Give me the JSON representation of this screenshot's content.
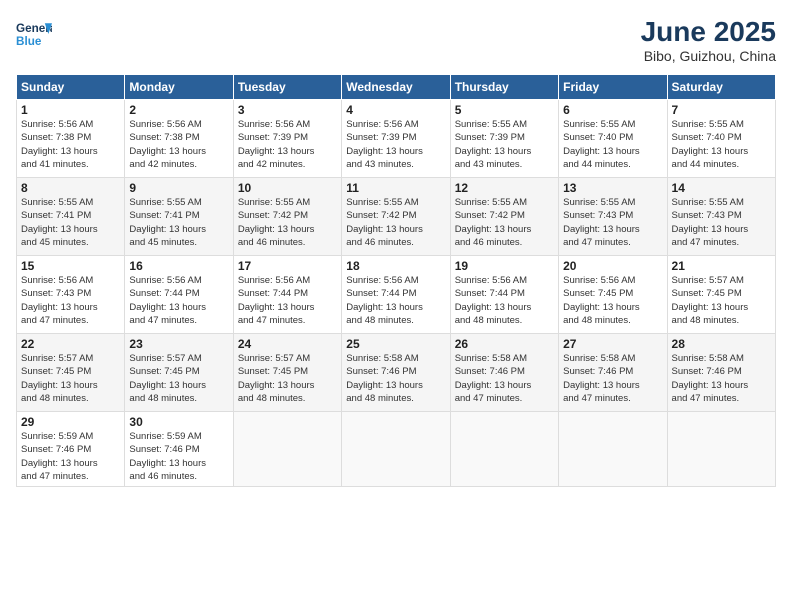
{
  "header": {
    "logo_line1": "General",
    "logo_line2": "Blue",
    "title": "June 2025",
    "subtitle": "Bibo, Guizhou, China"
  },
  "weekdays": [
    "Sunday",
    "Monday",
    "Tuesday",
    "Wednesday",
    "Thursday",
    "Friday",
    "Saturday"
  ],
  "weeks": [
    [
      {
        "day": "1",
        "sunrise": "5:56 AM",
        "sunset": "7:38 PM",
        "daylight": "13 hours and 41 minutes."
      },
      {
        "day": "2",
        "sunrise": "5:56 AM",
        "sunset": "7:38 PM",
        "daylight": "13 hours and 42 minutes."
      },
      {
        "day": "3",
        "sunrise": "5:56 AM",
        "sunset": "7:39 PM",
        "daylight": "13 hours and 42 minutes."
      },
      {
        "day": "4",
        "sunrise": "5:56 AM",
        "sunset": "7:39 PM",
        "daylight": "13 hours and 43 minutes."
      },
      {
        "day": "5",
        "sunrise": "5:55 AM",
        "sunset": "7:39 PM",
        "daylight": "13 hours and 43 minutes."
      },
      {
        "day": "6",
        "sunrise": "5:55 AM",
        "sunset": "7:40 PM",
        "daylight": "13 hours and 44 minutes."
      },
      {
        "day": "7",
        "sunrise": "5:55 AM",
        "sunset": "7:40 PM",
        "daylight": "13 hours and 44 minutes."
      }
    ],
    [
      {
        "day": "8",
        "sunrise": "5:55 AM",
        "sunset": "7:41 PM",
        "daylight": "13 hours and 45 minutes."
      },
      {
        "day": "9",
        "sunrise": "5:55 AM",
        "sunset": "7:41 PM",
        "daylight": "13 hours and 45 minutes."
      },
      {
        "day": "10",
        "sunrise": "5:55 AM",
        "sunset": "7:42 PM",
        "daylight": "13 hours and 46 minutes."
      },
      {
        "day": "11",
        "sunrise": "5:55 AM",
        "sunset": "7:42 PM",
        "daylight": "13 hours and 46 minutes."
      },
      {
        "day": "12",
        "sunrise": "5:55 AM",
        "sunset": "7:42 PM",
        "daylight": "13 hours and 46 minutes."
      },
      {
        "day": "13",
        "sunrise": "5:55 AM",
        "sunset": "7:43 PM",
        "daylight": "13 hours and 47 minutes."
      },
      {
        "day": "14",
        "sunrise": "5:55 AM",
        "sunset": "7:43 PM",
        "daylight": "13 hours and 47 minutes."
      }
    ],
    [
      {
        "day": "15",
        "sunrise": "5:56 AM",
        "sunset": "7:43 PM",
        "daylight": "13 hours and 47 minutes."
      },
      {
        "day": "16",
        "sunrise": "5:56 AM",
        "sunset": "7:44 PM",
        "daylight": "13 hours and 47 minutes."
      },
      {
        "day": "17",
        "sunrise": "5:56 AM",
        "sunset": "7:44 PM",
        "daylight": "13 hours and 47 minutes."
      },
      {
        "day": "18",
        "sunrise": "5:56 AM",
        "sunset": "7:44 PM",
        "daylight": "13 hours and 48 minutes."
      },
      {
        "day": "19",
        "sunrise": "5:56 AM",
        "sunset": "7:44 PM",
        "daylight": "13 hours and 48 minutes."
      },
      {
        "day": "20",
        "sunrise": "5:56 AM",
        "sunset": "7:45 PM",
        "daylight": "13 hours and 48 minutes."
      },
      {
        "day": "21",
        "sunrise": "5:57 AM",
        "sunset": "7:45 PM",
        "daylight": "13 hours and 48 minutes."
      }
    ],
    [
      {
        "day": "22",
        "sunrise": "5:57 AM",
        "sunset": "7:45 PM",
        "daylight": "13 hours and 48 minutes."
      },
      {
        "day": "23",
        "sunrise": "5:57 AM",
        "sunset": "7:45 PM",
        "daylight": "13 hours and 48 minutes."
      },
      {
        "day": "24",
        "sunrise": "5:57 AM",
        "sunset": "7:45 PM",
        "daylight": "13 hours and 48 minutes."
      },
      {
        "day": "25",
        "sunrise": "5:58 AM",
        "sunset": "7:46 PM",
        "daylight": "13 hours and 48 minutes."
      },
      {
        "day": "26",
        "sunrise": "5:58 AM",
        "sunset": "7:46 PM",
        "daylight": "13 hours and 47 minutes."
      },
      {
        "day": "27",
        "sunrise": "5:58 AM",
        "sunset": "7:46 PM",
        "daylight": "13 hours and 47 minutes."
      },
      {
        "day": "28",
        "sunrise": "5:58 AM",
        "sunset": "7:46 PM",
        "daylight": "13 hours and 47 minutes."
      }
    ],
    [
      {
        "day": "29",
        "sunrise": "5:59 AM",
        "sunset": "7:46 PM",
        "daylight": "13 hours and 47 minutes."
      },
      {
        "day": "30",
        "sunrise": "5:59 AM",
        "sunset": "7:46 PM",
        "daylight": "13 hours and 46 minutes."
      },
      null,
      null,
      null,
      null,
      null
    ]
  ],
  "labels": {
    "sunrise": "Sunrise:",
    "sunset": "Sunset:",
    "daylight": "Daylight:"
  }
}
